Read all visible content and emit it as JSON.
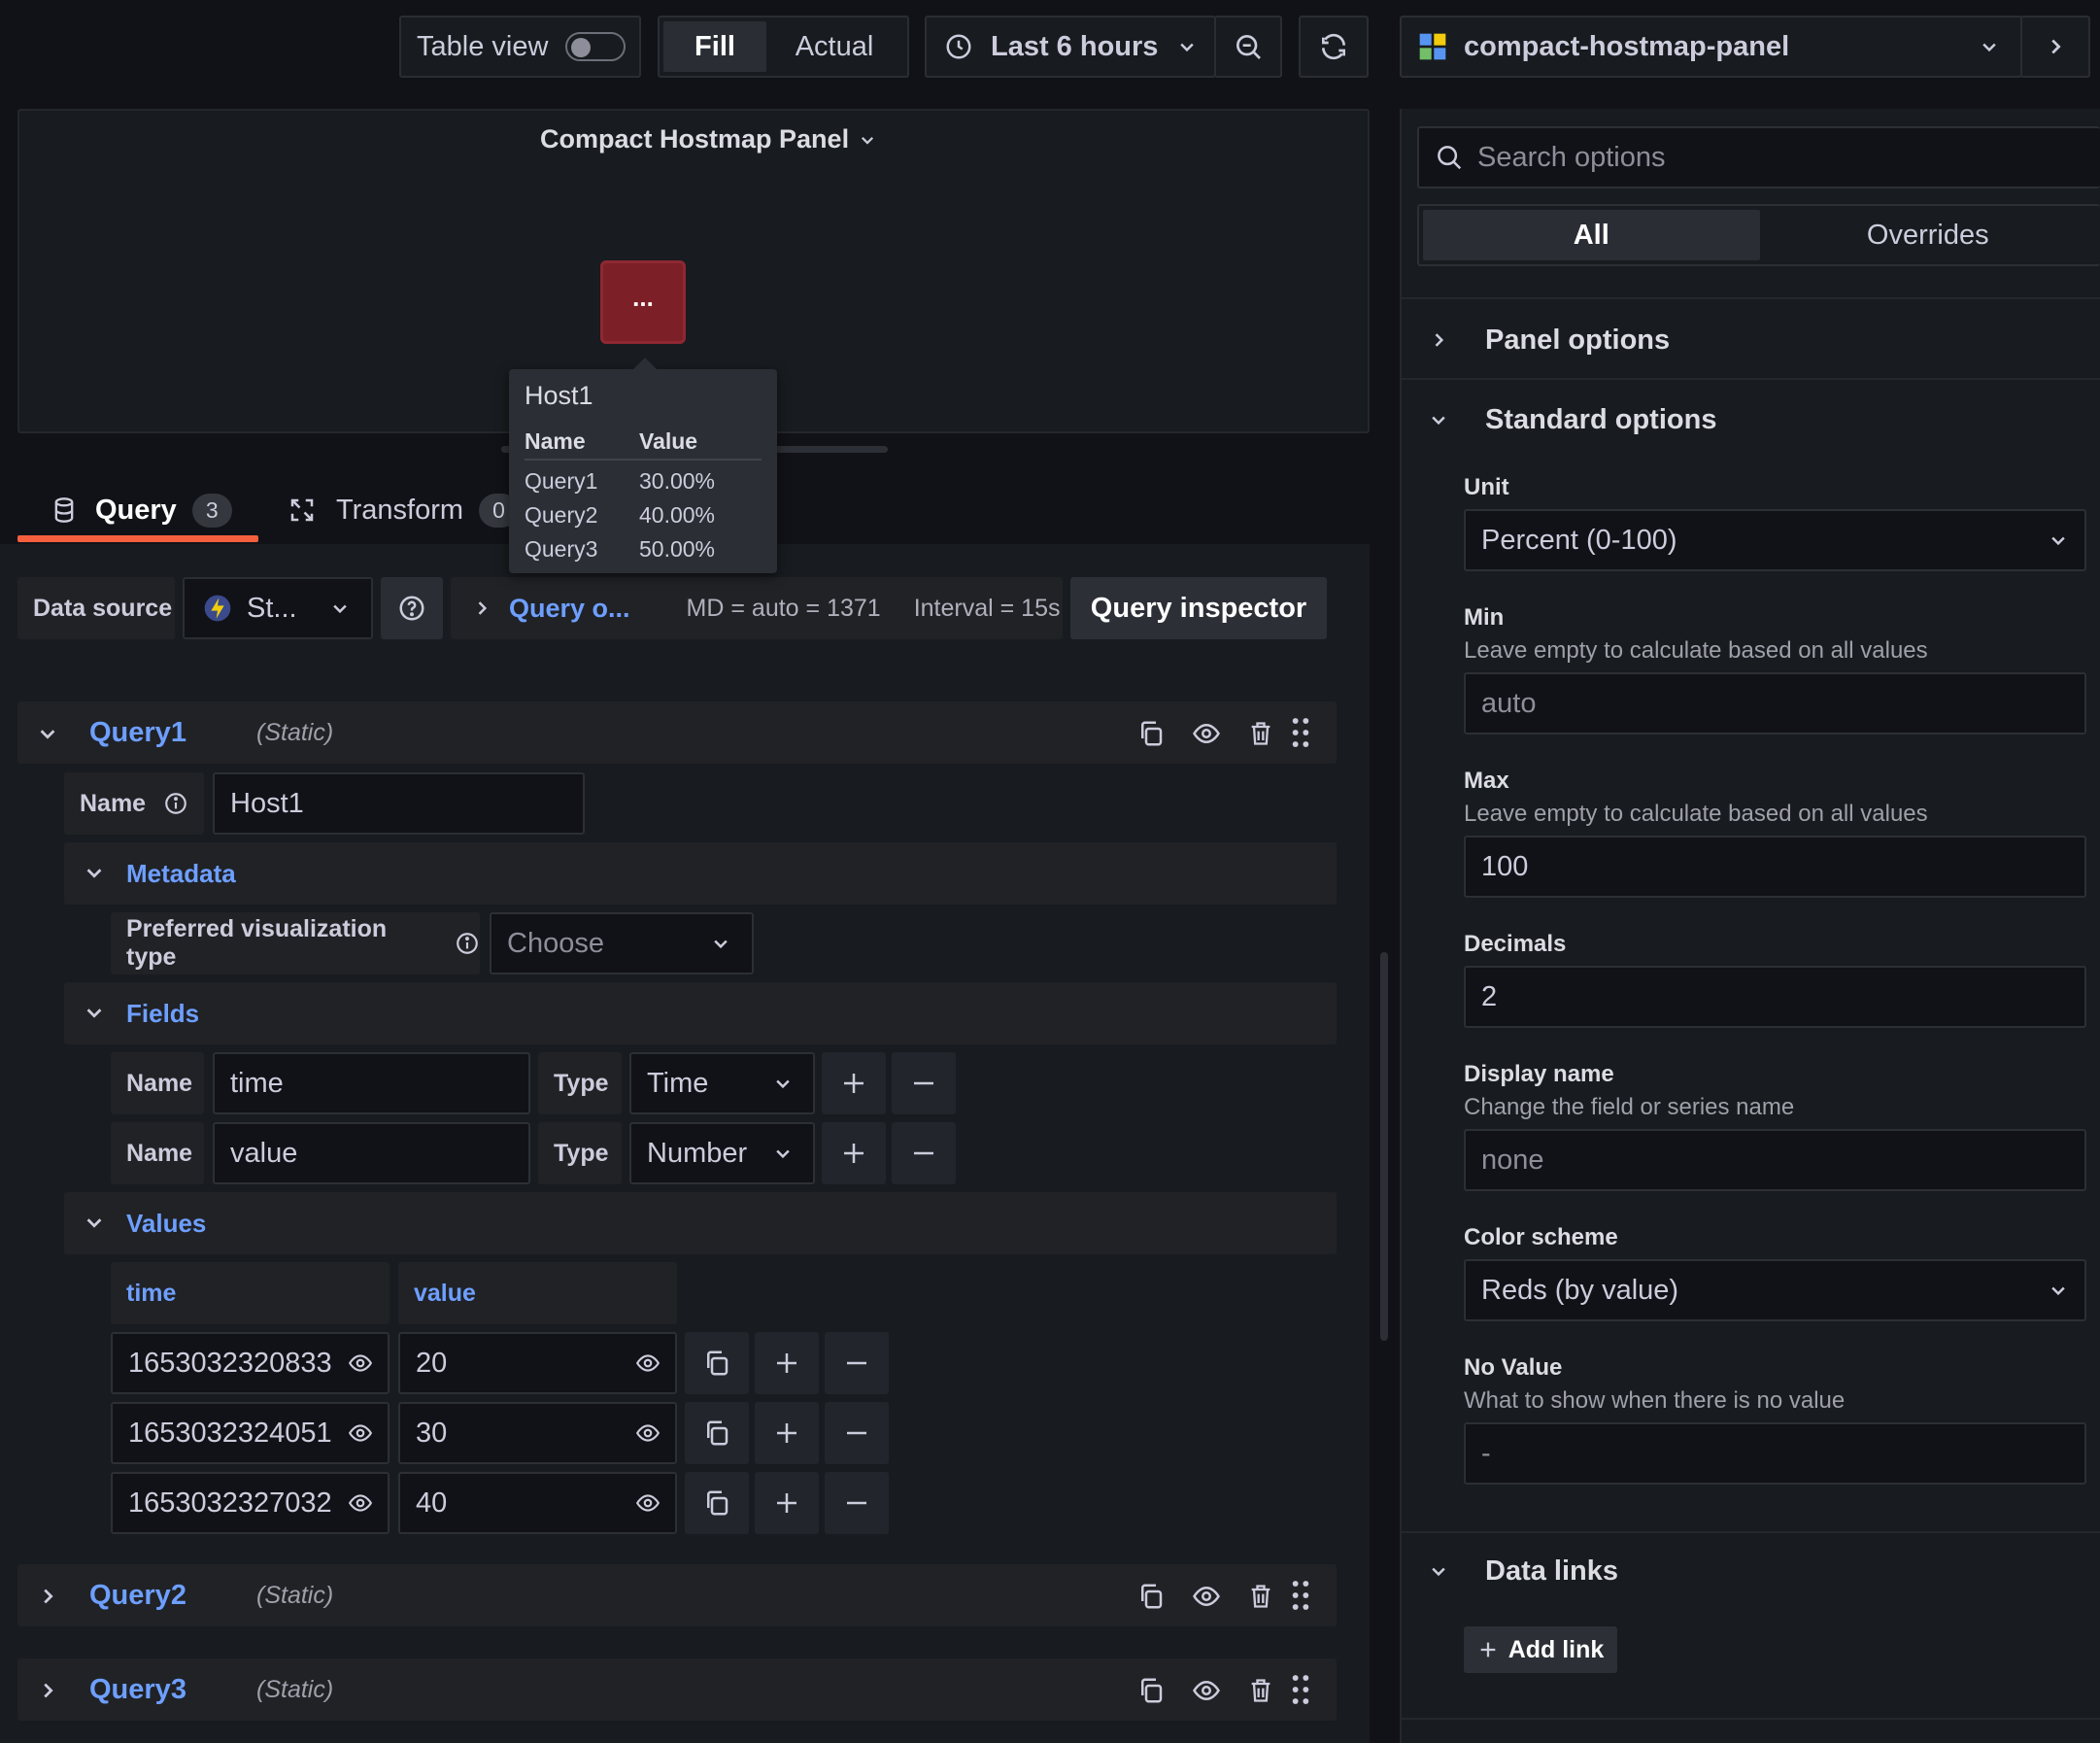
{
  "toolbar": {
    "table_view_label": "Table view",
    "fill_label": "Fill",
    "actual_label": "Actual",
    "time_range_label": "Last 6 hours",
    "visualization_name": "compact-hostmap-panel"
  },
  "panel": {
    "title": "Compact Hostmap Panel",
    "host_cell_text": "...",
    "host_color": "#7d1f27",
    "tooltip": {
      "title": "Host1",
      "col_name": "Name",
      "col_value": "Value",
      "rows": [
        {
          "name": "Query1",
          "value": "30.00%"
        },
        {
          "name": "Query2",
          "value": "40.00%"
        },
        {
          "name": "Query3",
          "value": "50.00%"
        }
      ]
    }
  },
  "tabs": {
    "query_label": "Query",
    "query_count": "3",
    "transform_label": "Transform",
    "transform_count": "0"
  },
  "query_bar": {
    "data_source_label": "Data source",
    "data_source_value": "St...",
    "query_options_label": "Query o...",
    "md_text": "MD = auto = 1371",
    "interval_text": "Interval = 15s",
    "inspector_label": "Query inspector"
  },
  "query1": {
    "title": "Query1",
    "type": "(Static)",
    "name_label": "Name",
    "name_value": "Host1",
    "metadata_label": "Metadata",
    "pref_vis_label": "Preferred visualization type",
    "pref_vis_placeholder": "Choose",
    "fields_label": "Fields",
    "fields": [
      {
        "name_label": "Name",
        "name": "time",
        "type_label": "Type",
        "type": "Time"
      },
      {
        "name_label": "Name",
        "name": "value",
        "type_label": "Type",
        "type": "Number"
      }
    ],
    "values_label": "Values",
    "values_headers": [
      "time",
      "value"
    ],
    "values_rows": [
      {
        "time": "1653032320833",
        "value": "20"
      },
      {
        "time": "1653032324051",
        "value": "30"
      },
      {
        "time": "1653032327032",
        "value": "40"
      }
    ]
  },
  "query2": {
    "title": "Query2",
    "type": "(Static)"
  },
  "query3": {
    "title": "Query3",
    "type": "(Static)"
  },
  "options": {
    "search_placeholder": "Search options",
    "tab_all": "All",
    "tab_overrides": "Overrides",
    "panel_options_label": "Panel options",
    "standard_options_label": "Standard options",
    "unit_label": "Unit",
    "unit_value": "Percent (0-100)",
    "min_label": "Min",
    "min_desc": "Leave empty to calculate based on all values",
    "min_placeholder": "auto",
    "max_label": "Max",
    "max_desc": "Leave empty to calculate based on all values",
    "max_value": "100",
    "decimals_label": "Decimals",
    "decimals_value": "2",
    "display_name_label": "Display name",
    "display_name_desc": "Change the field or series name",
    "display_name_placeholder": "none",
    "color_scheme_label": "Color scheme",
    "color_scheme_value": "Reds (by value)",
    "no_value_label": "No Value",
    "no_value_desc": "What to show when there is no value",
    "no_value_placeholder": "-",
    "data_links_label": "Data links",
    "add_link_label": "Add link"
  },
  "colors": {
    "accent_blue": "#6e9fff",
    "tab_underline": "#f55f3e"
  }
}
